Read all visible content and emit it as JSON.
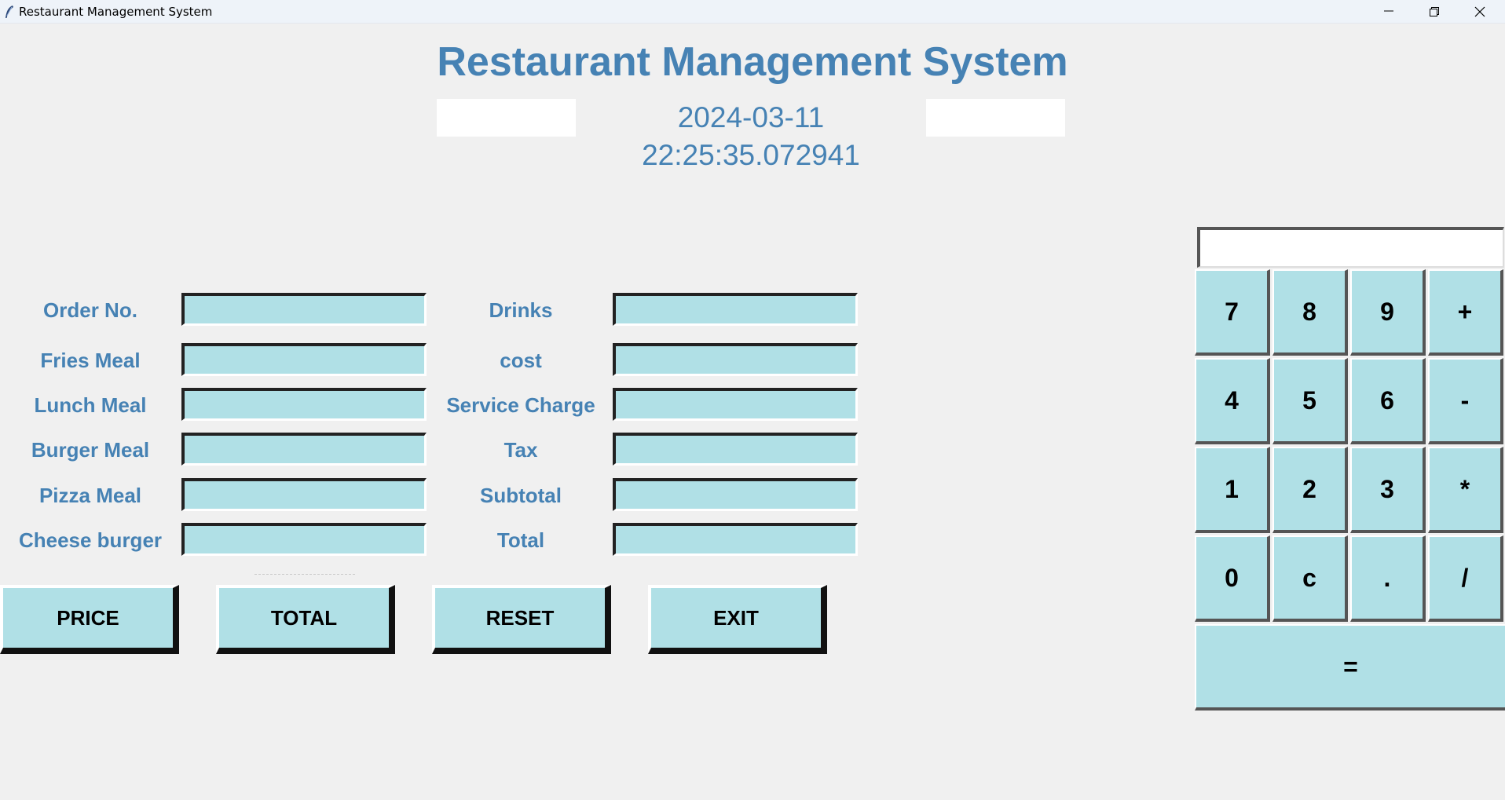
{
  "window": {
    "title": "Restaurant Management System"
  },
  "header": {
    "title": "Restaurant Management System",
    "datetime": "2024-03-11 22:25:35.072941"
  },
  "form": {
    "left_labels": [
      "Order No.",
      "Fries Meal",
      "Lunch Meal",
      "Burger Meal",
      "Pizza Meal",
      "Cheese burger"
    ],
    "right_labels": [
      "Drinks",
      "cost",
      "Service Charge",
      "Tax",
      "Subtotal",
      "Total"
    ],
    "left_values": [
      "",
      "",
      "",
      "",
      "",
      ""
    ],
    "right_values": [
      "",
      "",
      "",
      "",
      "",
      ""
    ]
  },
  "buttons": {
    "price": "PRICE",
    "total": "TOTAL",
    "reset": "RESET",
    "exit": "EXIT"
  },
  "calculator": {
    "display": "",
    "keys": [
      "7",
      "8",
      "9",
      "+",
      "4",
      "5",
      "6",
      "-",
      "1",
      "2",
      "3",
      "*",
      "0",
      "c",
      ".",
      "/"
    ],
    "equals": "="
  },
  "colors": {
    "accent": "#4682b4",
    "field_bg": "#b0e0e6",
    "window_bg": "#f0f0f0"
  }
}
